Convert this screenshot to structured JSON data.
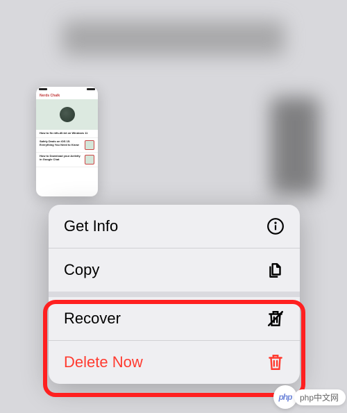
{
  "thumbnail": {
    "brand": "Nerds Chalk",
    "article1": "How to fix ntfs.dll.txt on Windows 11",
    "article2": "Safely Deals on iOS 15. Everything You Need to Know",
    "article3": "How to Download your Activity in Google Chat"
  },
  "menu": {
    "getInfo": "Get Info",
    "copy": "Copy",
    "recover": "Recover",
    "deleteNow": "Delete Now"
  },
  "watermark": {
    "logo": "php",
    "text": "php中文网"
  }
}
